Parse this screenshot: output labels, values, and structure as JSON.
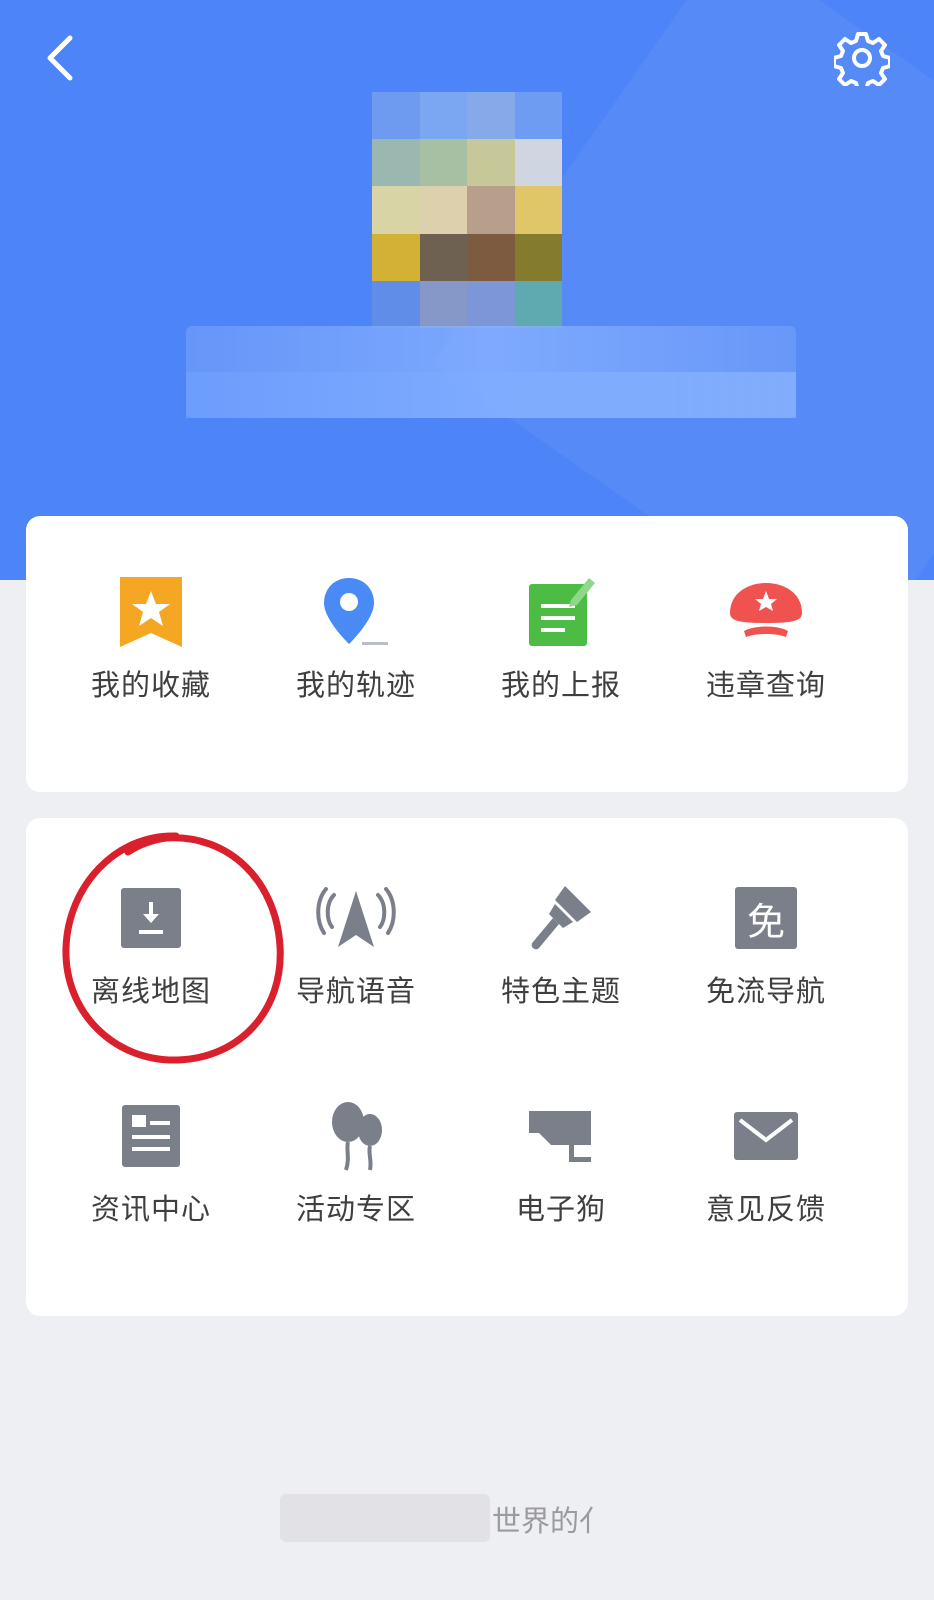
{
  "header": {
    "bg_color": "#4d84f7",
    "back_icon": "chevron-left-icon",
    "settings_icon": "gear-icon"
  },
  "quick_actions": [
    {
      "label": "我的收藏",
      "icon": "bookmark-star-icon",
      "color": "#f5a623"
    },
    {
      "label": "我的轨迹",
      "icon": "location-pin-icon",
      "color": "#4a8af4"
    },
    {
      "label": "我的上报",
      "icon": "report-note-icon",
      "color": "#4cbc45"
    },
    {
      "label": "违章查询",
      "icon": "police-cap-icon",
      "color": "#f0524f"
    }
  ],
  "tools": [
    {
      "label": "离线地图",
      "icon": "download-icon"
    },
    {
      "label": "导航语音",
      "icon": "navigation-arrow-icon"
    },
    {
      "label": "特色主题",
      "icon": "paint-brush-icon"
    },
    {
      "label": "免流导航",
      "icon": "free-data-icon",
      "glyph": "免"
    },
    {
      "label": "资讯中心",
      "icon": "news-icon"
    },
    {
      "label": "活动专区",
      "icon": "balloons-icon"
    },
    {
      "label": "电子狗",
      "icon": "camera-icon"
    },
    {
      "label": "意见反馈",
      "icon": "mail-icon"
    }
  ],
  "footer": {
    "text": "世界的亻"
  },
  "colors": {
    "icon_gray": "#7a7f8a",
    "annotation_red": "#d9202c"
  }
}
